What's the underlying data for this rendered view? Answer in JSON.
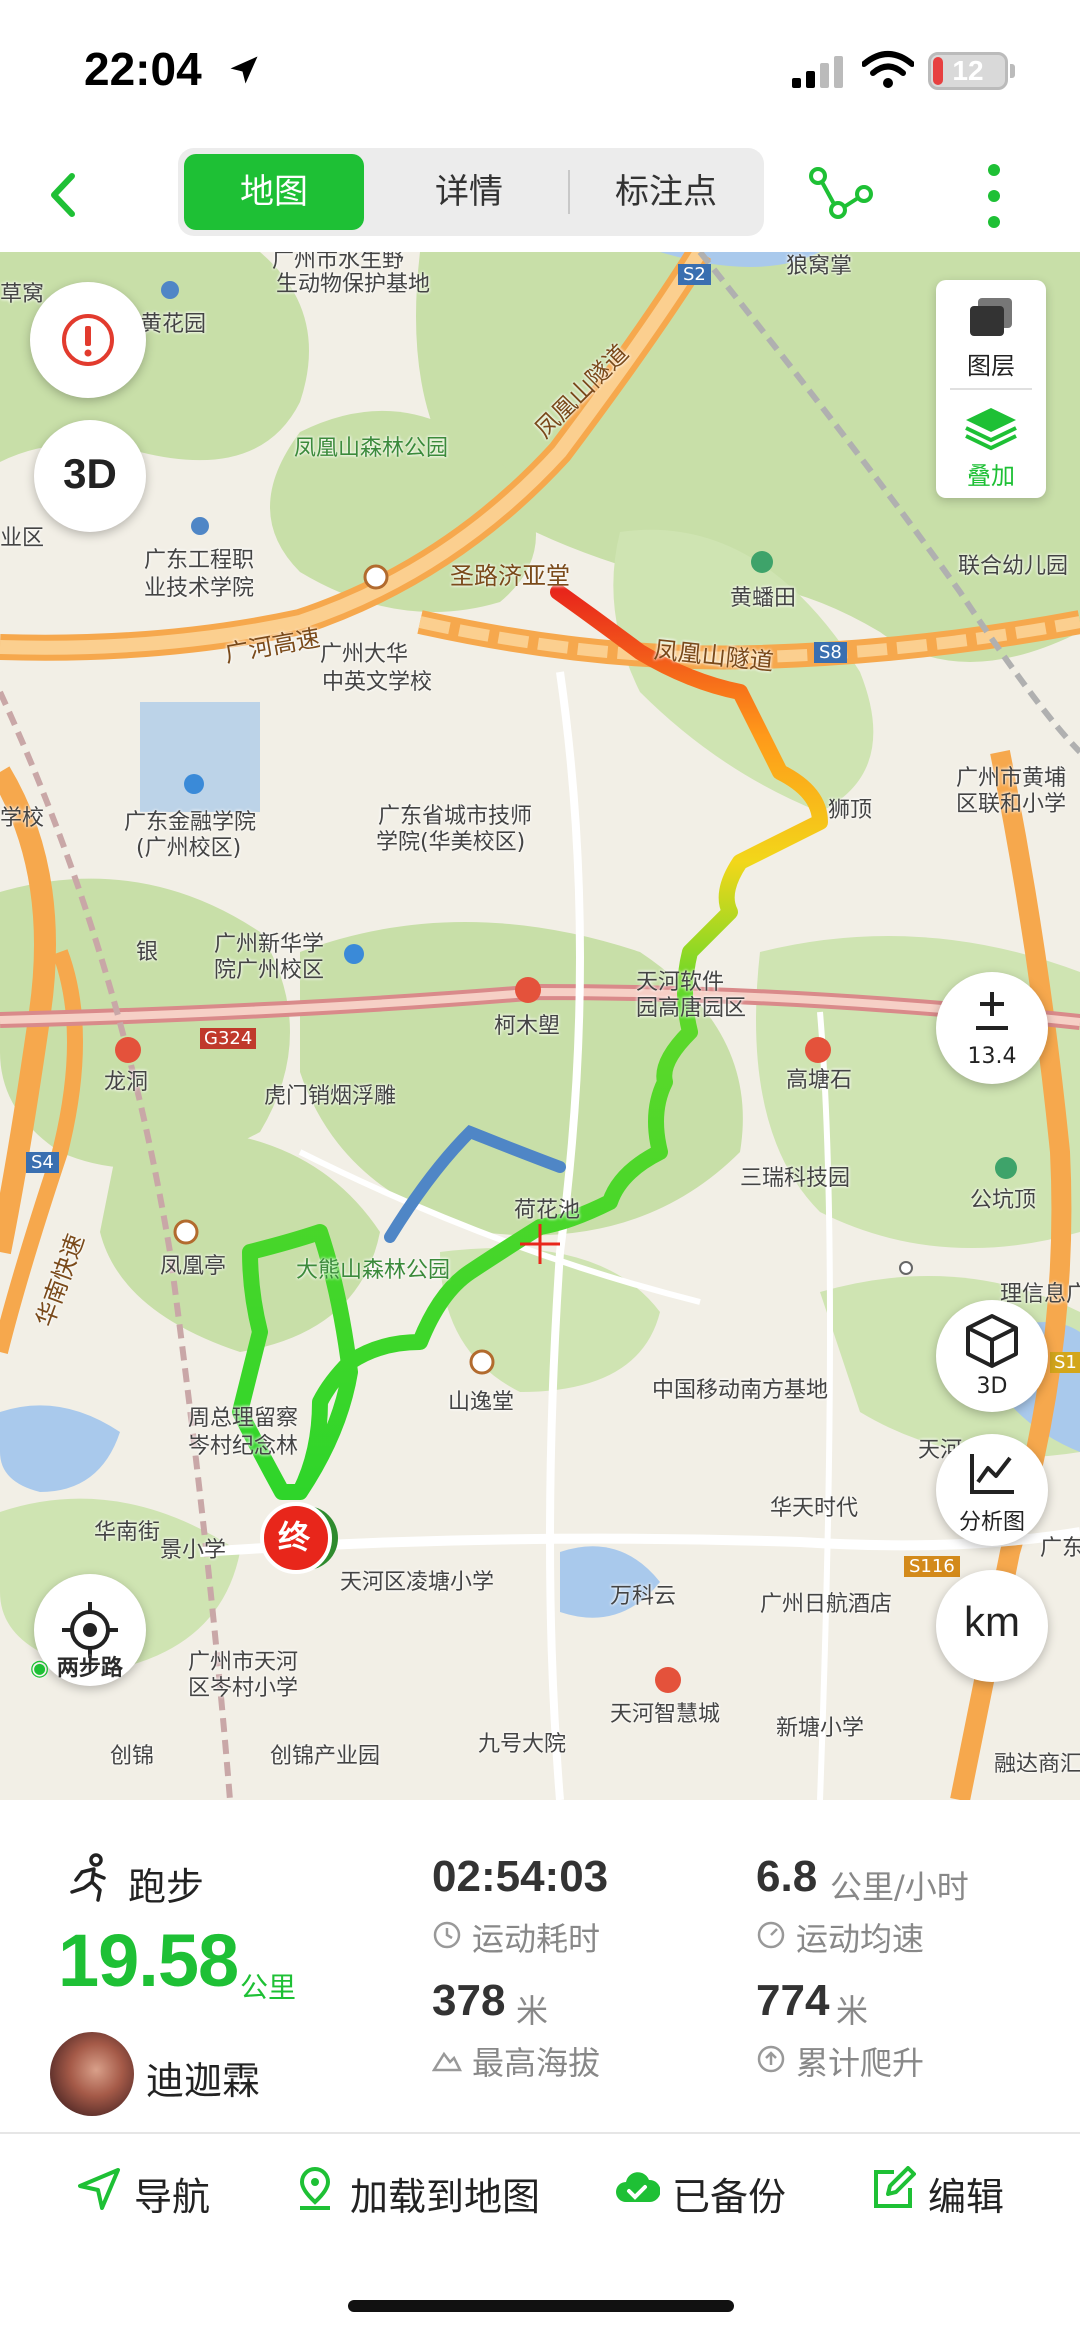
{
  "status_bar": {
    "time": "22:04",
    "battery": "12",
    "location_icon": "location-arrow-icon",
    "signal_icon": "cellular-signal-icon",
    "wifi_icon": "wifi-icon"
  },
  "nav": {
    "back_icon": "chevron-left-icon",
    "tabs": [
      {
        "label": "地图",
        "active": true
      },
      {
        "label": "详情",
        "active": false
      },
      {
        "label": "标注点",
        "active": false
      }
    ],
    "route_icon": "route-share-icon",
    "more_icon": "more-vertical-icon"
  },
  "map": {
    "alert_icon": "alert-circle-icon",
    "btn_3d_top": "3D",
    "layers": {
      "label": "图层",
      "icon": "layers-icon"
    },
    "overlay": {
      "label": "叠加",
      "icon": "stack-icon"
    },
    "zoom": {
      "icon": "plus-minus-icon",
      "value": "13.4"
    },
    "btn_3d": {
      "label": "3D",
      "icon": "cube-icon"
    },
    "analysis": {
      "label": "分析图",
      "icon": "line-chart-icon"
    },
    "unit_btn": "km",
    "locate_icon": "crosshair-icon",
    "end_marker": "终",
    "brand": "两步路",
    "labels": [
      "广州市水生野",
      "生动物保护基地",
      "草窝",
      "黄花园",
      "狼窝掌",
      "凤凰山森林公园",
      "凤凰山隧道",
      "广东工程职",
      "业技术学院",
      "业区",
      "圣路济亚堂",
      "黄蟠田",
      "联合幼儿园",
      "广河高速",
      "广州大华",
      "中英文学校",
      "凤凰山隧道",
      "广东金融学院",
      "(广州校区)",
      "广东省城市技师",
      "学院(华美校区)",
      "广州市黄埔",
      "区联和小学",
      "学校",
      "广州新华学",
      "院广州校区",
      "天河软件",
      "园高唐园区",
      "柯木塱",
      "龙洞",
      "G324",
      "虎门销烟浮雕",
      "高塘石",
      "三瑞科技园",
      "公坑顶",
      "凤凰亭",
      "荷花池",
      "大熊山森林公园",
      "山逸堂",
      "中国移动南方基地",
      "周总理留察",
      "岑村纪念林",
      "华南街",
      "景小学",
      "华天时代",
      "天河区凌塘小学",
      "万科云",
      "广州日航酒店",
      "广州市天河",
      "区岑村小学",
      "天河智慧城",
      "九号大院",
      "新塘小学",
      "创锦产业园",
      "融达商汇",
      "创锦",
      "S2",
      "S8",
      "S4",
      "S116",
      "华南快速",
      "银",
      "狮顶",
      "理信息广",
      "天河",
      "广东学院",
      "S1"
    ]
  },
  "stats": {
    "sport": "跑步",
    "sport_icon": "running-icon",
    "distance": "19.58",
    "distance_unit": "公里",
    "username": "迪迦霖",
    "duration": {
      "value": "02:54:03",
      "label": "运动耗时",
      "icon": "clock-icon"
    },
    "speed": {
      "value": "6.8",
      "unit": "公里/小时",
      "label": "运动均速",
      "icon": "speed-icon"
    },
    "max_alt": {
      "value": "378",
      "unit": "米",
      "label": "最高海拔",
      "icon": "altitude-icon"
    },
    "climb": {
      "value": "774",
      "unit": "米",
      "label": "累计爬升",
      "icon": "climb-icon"
    }
  },
  "toolbar": {
    "navigate": {
      "label": "导航",
      "icon": "navigation-icon"
    },
    "load_map": {
      "label": "加载到地图",
      "icon": "map-pin-icon"
    },
    "backup": {
      "label": "已备份",
      "icon": "cloud-check-icon"
    },
    "edit": {
      "label": "编辑",
      "icon": "edit-icon"
    }
  },
  "colors": {
    "accent": "#1ec035",
    "route_start": "#e8261b",
    "route_mid": "#ff9a1a",
    "route_end": "#2fd52a",
    "route_blue": "#4f86c6"
  }
}
